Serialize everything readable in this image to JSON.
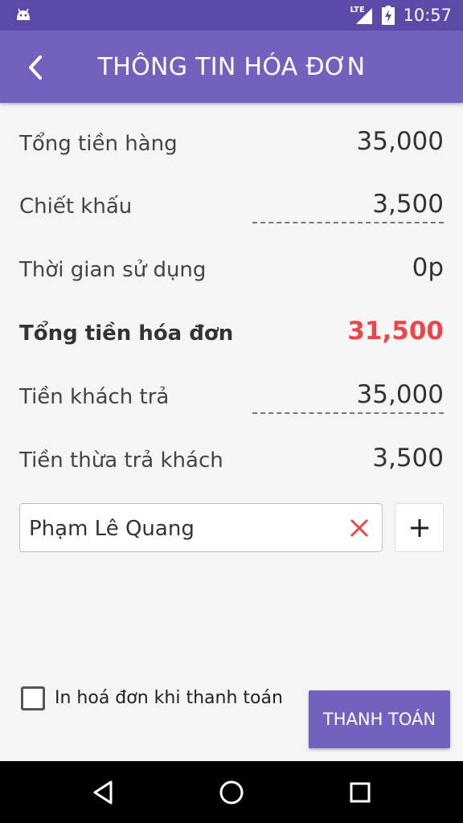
{
  "status_bar": {
    "network": "LTE",
    "time": "10:57"
  },
  "app_bar": {
    "title": "THÔNG TIN HÓA ĐƠN",
    "back_icon": "chevron-left-icon"
  },
  "invoice": {
    "subtotal_label": "Tổng tiền hàng",
    "subtotal_value": "35,000",
    "discount_label": "Chiết khấu",
    "discount_value": "3,500",
    "usage_time_label": "Thời gian sử dụng",
    "usage_time_value": "0p",
    "total_label": "Tổng tiền hóa đơn",
    "total_value": "31,500",
    "customer_paid_label": "Tiền khách trả",
    "customer_paid_value": "35,000",
    "change_label": "Tiền thừa trả khách",
    "change_value": "3,500"
  },
  "customer": {
    "name": "Phạm Lê Quang",
    "clear_icon": "close-icon",
    "add_icon": "plus-icon"
  },
  "footer": {
    "print_checkbox_label": "In hoá đơn khi thanh toán",
    "print_checked": false,
    "pay_button_label": "THANH TOÁN"
  },
  "colors": {
    "status_bar": "#5b4aa7",
    "primary": "#7461bd",
    "total_red": "#e8474b",
    "clear_red": "#e8474b"
  },
  "nav_bar": {
    "back_icon": "nav-back-icon",
    "home_icon": "nav-home-icon",
    "recents_icon": "nav-recents-icon"
  }
}
